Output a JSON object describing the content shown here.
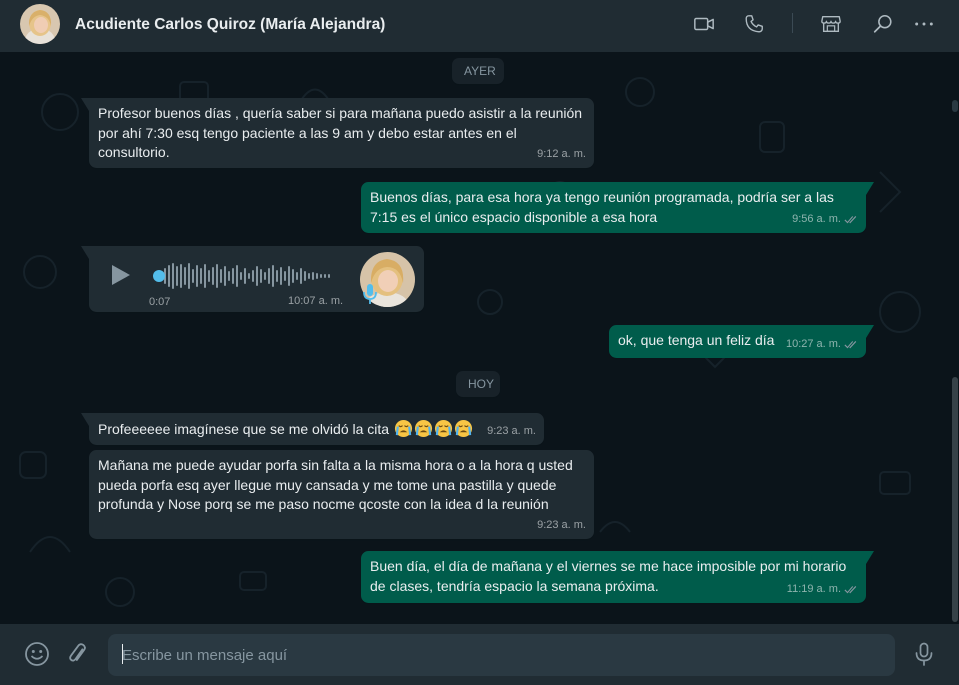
{
  "header": {
    "contact_name": "Acudiente Carlos Quiroz (María Alejandra)",
    "icons": [
      "video-call-icon",
      "voice-call-icon",
      "business-catalog-icon",
      "search-icon",
      "more-options-icon"
    ]
  },
  "days": {
    "yesterday": "AYER",
    "today": "HOY"
  },
  "messages": {
    "m1": {
      "direction": "in",
      "text": "Profesor buenos días , quería saber si para mañana puedo asistir a la reunión por ahí 7:30 esq tengo paciente a las 9 am y debo estar antes en el consultorio.",
      "time": "9:12 a. m."
    },
    "m2": {
      "direction": "out",
      "text": "Buenos días, para esa hora ya tengo reunión programada, podría ser a las 7:15 es el único espacio disponible a esa hora",
      "time": "9:56 a. m.",
      "status": "read"
    },
    "m3": {
      "direction": "in",
      "type": "voice",
      "duration": "0:07",
      "time": "10:07 a. m.",
      "progress": 0.0
    },
    "m4": {
      "direction": "out",
      "text": "ok, que tenga un feliz día",
      "time": "10:27 a. m.",
      "status": "read"
    },
    "m5": {
      "direction": "in",
      "text": "Profeeeeee imagínese que se me olvidó la cita",
      "emoji": [
        "loudly-crying-face",
        "loudly-crying-face",
        "loudly-crying-face",
        "loudly-crying-face"
      ],
      "time": "9:23 a. m."
    },
    "m6": {
      "direction": "in",
      "text": "Mañana me puede ayudar porfa sin falta a la misma hora o a la hora q usted pueda porfa esq ayer llegue muy cansada y me tome una pastilla y quede profunda y Nose porq se me paso nocme qcoste con la idea d la reunión",
      "time": "9:23 a. m."
    },
    "m7": {
      "direction": "out",
      "text": "Buen día, el día de mañana y el viernes se me hace imposible por mi horario de clases, tendría espacio la semana próxima.",
      "time": "11:19 a. m.",
      "status": "read"
    }
  },
  "composer": {
    "placeholder": "Escribe un mensaje aquí",
    "value": ""
  },
  "colors": {
    "incoming_bubble": "#202c33",
    "outgoing_bubble": "#005c4b",
    "read_ticks": "#8696a0",
    "voice_progress": "#53bdeb"
  }
}
